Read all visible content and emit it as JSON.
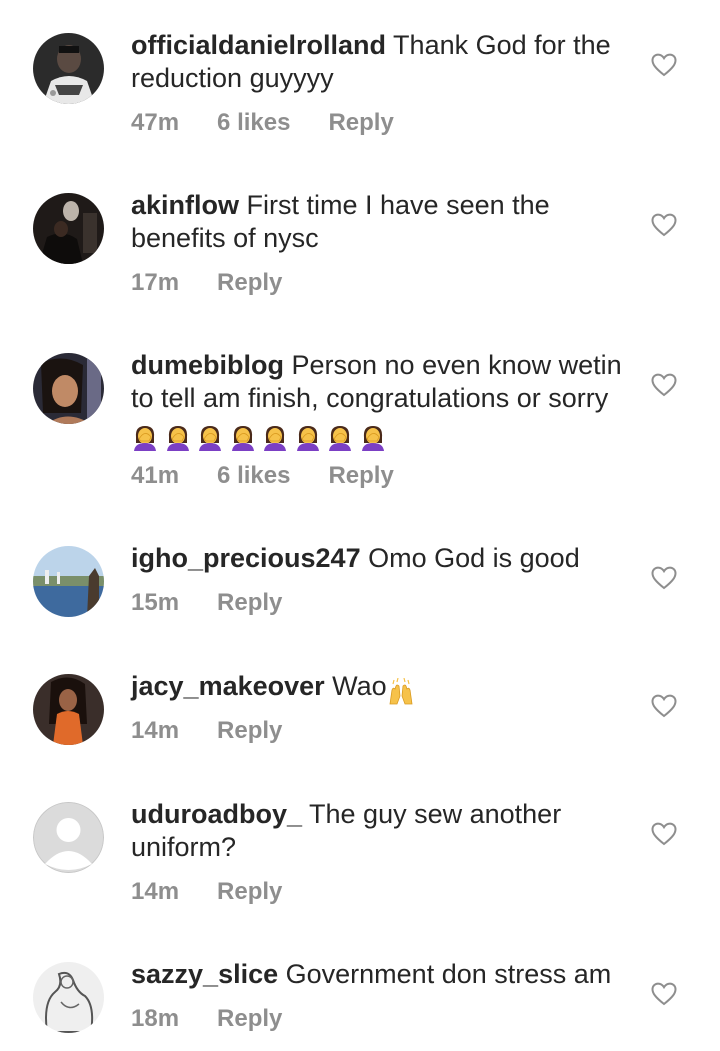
{
  "comments": [
    {
      "username": "officialdanielrolland",
      "text": " Thank God for the reduction guyyyy",
      "time": "47m",
      "likes": "6 likes",
      "reply": "Reply",
      "avatar": "dark-portrait-avatar"
    },
    {
      "username": "akinflow",
      "text": " First time I have seen the benefits of nysc",
      "time": "17m",
      "likes": "",
      "reply": "Reply",
      "avatar": "dark-room-avatar"
    },
    {
      "username": "dumebiblog",
      "text": " Person no even know wetin to tell am finish, congratulations or sorry ",
      "emoji_name": "woman-facepalming-emoji",
      "emoji_count": 8,
      "time": "41m",
      "likes": "6 likes",
      "reply": "Reply",
      "avatar": "woman-portrait-avatar"
    },
    {
      "username": "igho_precious247",
      "text": " Omo God is good",
      "time": "15m",
      "likes": "",
      "reply": "Reply",
      "avatar": "landscape-avatar"
    },
    {
      "username": "jacy_makeover",
      "text": " Wao",
      "emoji_name": "raising-hands-emoji",
      "emoji_count": 1,
      "time": "14m",
      "likes": "",
      "reply": "Reply",
      "avatar": "orange-dress-avatar"
    },
    {
      "username": "uduroadboy_",
      "text": " The guy sew another uniform?",
      "time": "14m",
      "likes": "",
      "reply": "Reply",
      "avatar": "default-user-avatar"
    },
    {
      "username": "sazzy_slice",
      "text": " Government don stress am",
      "time": "18m",
      "likes": "",
      "reply": "Reply",
      "avatar": "sketch-avatar"
    }
  ],
  "colors": {
    "text": "#262626",
    "meta": "#8e8e8e",
    "heart_stroke": "#8e8e8e",
    "facepalm_hair": "#4a2a1a",
    "facepalm_shirt": "#7b3fc4",
    "facepalm_skin": "#f6c24a",
    "raising_hands": "#f6c24a"
  },
  "icons": {
    "like": "heart-outline-icon"
  }
}
